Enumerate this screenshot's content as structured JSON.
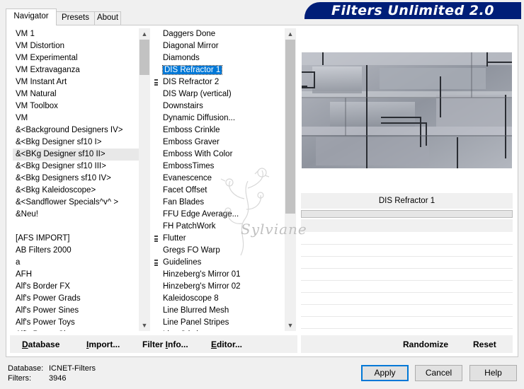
{
  "window": {
    "title": "Filters Unlimited 2.0"
  },
  "tabs": [
    {
      "label": "Navigator",
      "active": true
    },
    {
      "label": "Presets",
      "active": false
    },
    {
      "label": "About",
      "active": false
    }
  ],
  "categories": {
    "items": [
      "VM 1",
      "VM Distortion",
      "VM Experimental",
      "VM Extravaganza",
      "VM Instant Art",
      "VM Natural",
      "VM Toolbox",
      "VM",
      "&<Background Designers IV>",
      "&<Bkg Designer sf10 I>",
      "&<BKg Designer sf10 II>",
      "&<Bkg Designer sf10 III>",
      "&<Bkg Designers sf10 IV>",
      "&<Bkg Kaleidoscope>",
      "&<Sandflower Specials^v^ >",
      "&Neu!",
      "",
      "[AFS IMPORT]",
      "AB Filters 2000",
      "a",
      "AFH",
      "Alf's Border FX",
      "Alf's Power Grads",
      "Alf's Power Sines",
      "Alf's Power Toys",
      "Alf's Power Sines"
    ],
    "highlighted_index": 10
  },
  "filters": {
    "items": [
      {
        "label": "Daggers Done"
      },
      {
        "label": "Diagonal Mirror"
      },
      {
        "label": "Diamonds"
      },
      {
        "label": "DIS Refractor 1",
        "selected": true
      },
      {
        "label": "DIS Refractor 2",
        "marked": true
      },
      {
        "label": "DIS Warp (vertical)"
      },
      {
        "label": "Downstairs"
      },
      {
        "label": "Dynamic Diffusion..."
      },
      {
        "label": "Emboss Crinkle"
      },
      {
        "label": "Emboss Graver"
      },
      {
        "label": "Emboss With Color"
      },
      {
        "label": "EmbossTimes"
      },
      {
        "label": "Evanescence"
      },
      {
        "label": "Facet Offset"
      },
      {
        "label": "Fan Blades"
      },
      {
        "label": "FFU Edge Average..."
      },
      {
        "label": "FH PatchWork"
      },
      {
        "label": "Flutter",
        "marked": true
      },
      {
        "label": "Gregs FO Warp"
      },
      {
        "label": "Guidelines",
        "marked": true
      },
      {
        "label": "Hinzeberg's Mirror 01"
      },
      {
        "label": "Hinzeberg's Mirror 02"
      },
      {
        "label": "Kaleidoscope 8"
      },
      {
        "label": "Line Blurred Mesh"
      },
      {
        "label": "Line Panel Stripes"
      },
      {
        "label": "Line Stitches"
      }
    ]
  },
  "preview": {
    "filter_name": "DIS Refractor 1",
    "progress": 0
  },
  "watermark": {
    "text": "Sylviane"
  },
  "bottom_buttons": {
    "database": {
      "prefix": "D",
      "rest": "atabase"
    },
    "import": {
      "prefix": "I",
      "rest": "mport..."
    },
    "filter_info": {
      "prefix": "Filter ",
      "u": "I",
      "rest": "nfo..."
    },
    "editor": {
      "prefix": "E",
      "rest": "ditor..."
    },
    "randomize": "Randomize",
    "reset": "Reset"
  },
  "status": {
    "database_label": "Database:",
    "database_value": "ICNET-Filters",
    "filters_label": "Filters:",
    "filters_value": "3946"
  },
  "dialog_buttons": {
    "apply": "Apply",
    "cancel": "Cancel",
    "help": "Help"
  },
  "colors": {
    "banner": "#001e78",
    "selection": "#0078d7",
    "preview_bg": "#9fa4ae"
  }
}
